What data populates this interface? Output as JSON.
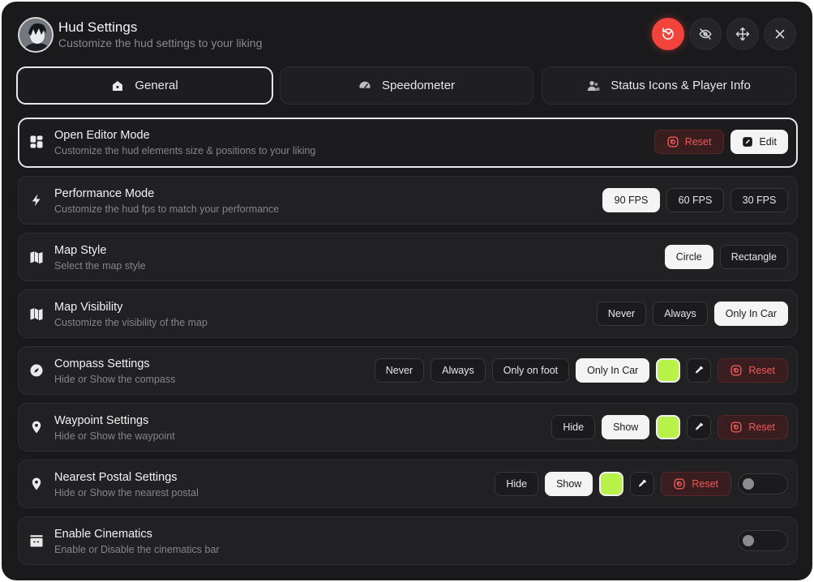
{
  "header": {
    "title": "Hud Settings",
    "subtitle": "Customize the hud settings to your liking",
    "icons": [
      "reset-all-icon",
      "eye-off-icon",
      "move-icon",
      "close-icon"
    ],
    "accent_color": "#f2443c"
  },
  "tabs": [
    {
      "label": "General",
      "icon": "home-icon",
      "active": true
    },
    {
      "label": "Speedometer",
      "icon": "gauge-icon",
      "active": false
    },
    {
      "label": "Status Icons & Player Info",
      "icon": "users-icon",
      "active": false
    }
  ],
  "rows": {
    "editor": {
      "title": "Open Editor Mode",
      "desc": "Customize the hud elements size & positions to your liking",
      "reset_label": "Reset",
      "edit_label": "Edit"
    },
    "performance": {
      "title": "Performance Mode",
      "desc": "Customize the hud fps to match your performance",
      "options": [
        "90 FPS",
        "60 FPS",
        "30 FPS"
      ],
      "selected": "90 FPS"
    },
    "map_style": {
      "title": "Map Style",
      "desc": "Select the map style",
      "options": [
        "Circle",
        "Rectangle"
      ],
      "selected": "Circle"
    },
    "map_visibility": {
      "title": "Map Visibility",
      "desc": "Customize the visibility of the map",
      "options": [
        "Never",
        "Always",
        "Only In Car"
      ],
      "selected": "Only In Car"
    },
    "compass": {
      "title": "Compass Settings",
      "desc": "Hide or Show the compass",
      "options": [
        "Never",
        "Always",
        "Only on foot",
        "Only In Car"
      ],
      "selected": "Only In Car",
      "color": "#b7f14a",
      "reset_label": "Reset"
    },
    "waypoint": {
      "title": "Waypoint Settings",
      "desc": "Hide or Show the waypoint",
      "options": [
        "Hide",
        "Show"
      ],
      "selected": "Show",
      "color": "#b7f14a",
      "reset_label": "Reset"
    },
    "postal": {
      "title": "Nearest Postal Settings",
      "desc": "Hide or Show the nearest postal",
      "options": [
        "Hide",
        "Show"
      ],
      "selected": "Show",
      "color": "#b7f14a",
      "reset_label": "Reset",
      "toggle_on": false
    },
    "cinematics": {
      "title": "Enable Cinematics",
      "desc": "Enable or Disable the cinematics bar",
      "toggle_on": false
    }
  }
}
